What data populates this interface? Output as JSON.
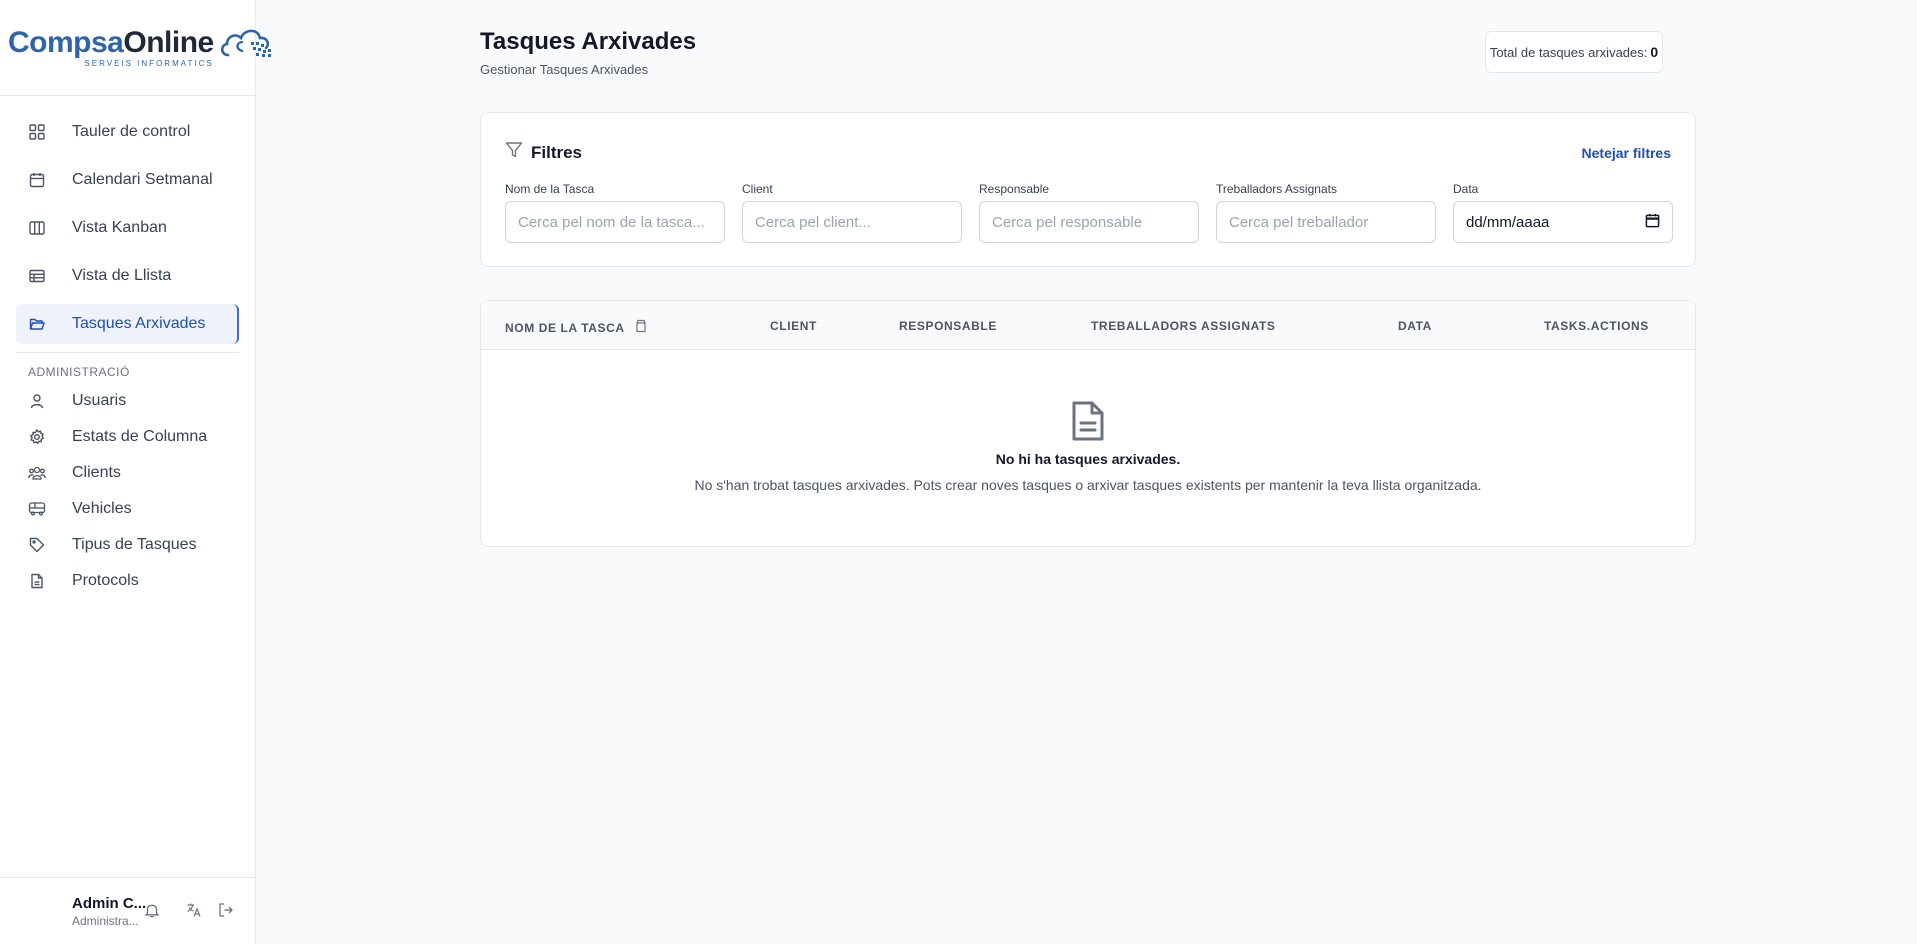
{
  "brand": {
    "name_part1": "Compsa",
    "name_part2": "Online",
    "tagline": "SERVEIS INFORMATICS"
  },
  "sidebar": {
    "items": [
      {
        "label": "Tauler de control",
        "icon": "dashboard-grid-icon"
      },
      {
        "label": "Calendari Setmanal",
        "icon": "calendar-icon"
      },
      {
        "label": "Vista Kanban",
        "icon": "kanban-columns-icon"
      },
      {
        "label": "Vista de Llista",
        "icon": "list-table-icon"
      },
      {
        "label": "Tasques Arxivades",
        "icon": "folder-open-icon",
        "active": true
      }
    ],
    "admin_title": "ADMINISTRACIÓ",
    "admin_items": [
      {
        "label": "Usuaris",
        "icon": "user-icon"
      },
      {
        "label": "Estats de Columna",
        "icon": "gear-icon"
      },
      {
        "label": "Clients",
        "icon": "users-group-icon"
      },
      {
        "label": "Vehicles",
        "icon": "bus-icon"
      },
      {
        "label": "Tipus de Tasques",
        "icon": "tag-icon"
      },
      {
        "label": "Protocols",
        "icon": "document-icon"
      }
    ]
  },
  "user": {
    "name": "Admin C...",
    "role": "Administra..."
  },
  "header": {
    "title": "Tasques Arxivades",
    "subtitle": "Gestionar Tasques Arxivades",
    "total_label": "Total de tasques arxivades:",
    "total_value": "0"
  },
  "filters": {
    "title": "Filtres",
    "clear_label": "Netejar filtres",
    "fields": [
      {
        "label": "Nom de la Tasca",
        "placeholder": "Cerca pel nom de la tasca...",
        "value": ""
      },
      {
        "label": "Client",
        "placeholder": "Cerca pel client...",
        "value": ""
      },
      {
        "label": "Responsable",
        "placeholder": "Cerca pel responsable",
        "value": ""
      },
      {
        "label": "Treballadors Assignats",
        "placeholder": "Cerca pel treballador",
        "value": ""
      }
    ],
    "date": {
      "label": "Data",
      "value": "dd/mm/aaaa"
    }
  },
  "table": {
    "columns": [
      "NOM DE LA TASCA",
      "CLIENT",
      "RESPONSABLE",
      "TREBALLADORS ASSIGNATS",
      "DATA",
      "TASKS.ACTIONS"
    ],
    "empty_title": "No hi ha tasques arxivades.",
    "empty_text": "No s'han trobat tasques arxivades. Pots crear noves tasques o arxivar tasques existents per mantenir la teva llista organitzada."
  },
  "colors": {
    "accent": "#1e4fb5",
    "brand_blue": "#2f64a8",
    "active_bg": "#eef2fb"
  }
}
